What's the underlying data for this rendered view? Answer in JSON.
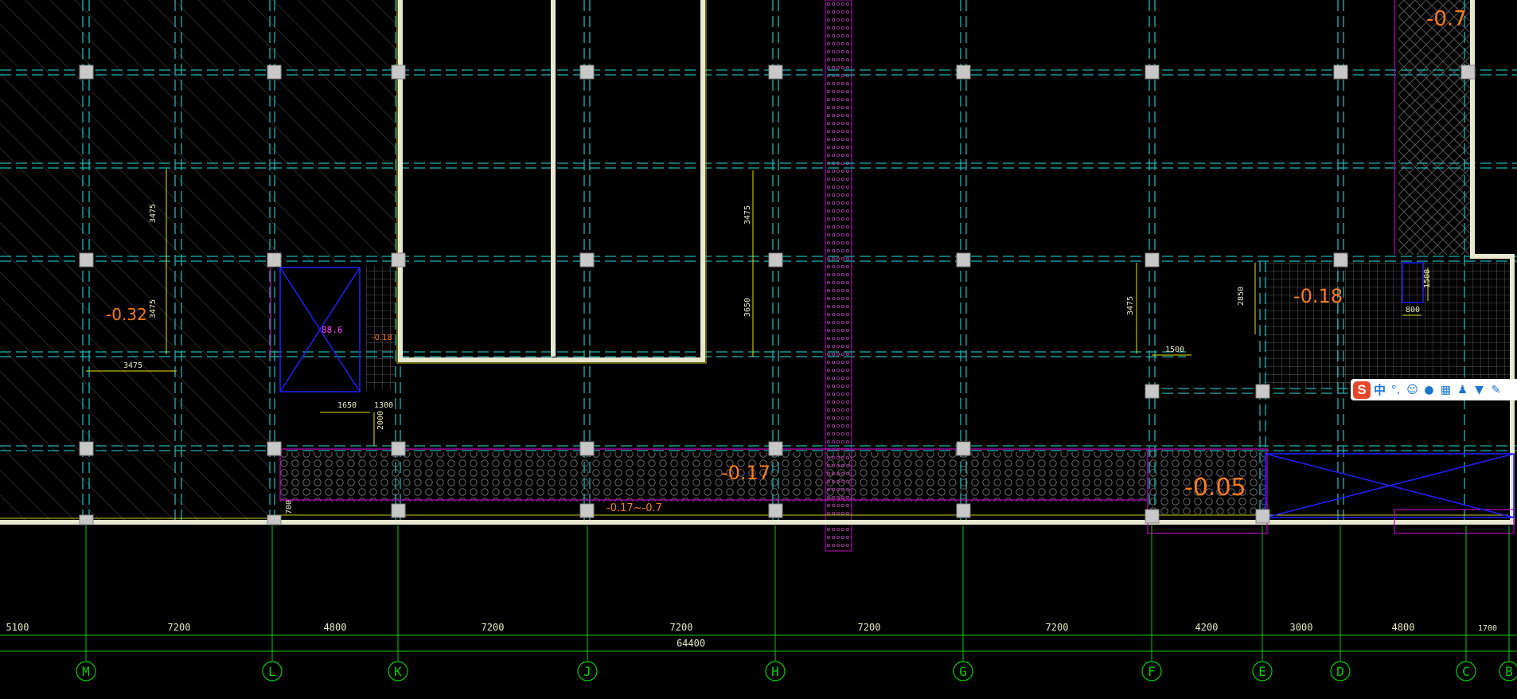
{
  "axis_labels": [
    "M",
    "L",
    "K",
    "J",
    "H",
    "G",
    "F",
    "E",
    "D",
    "C",
    "B"
  ],
  "spans": [
    "5100",
    "7200",
    "4800",
    "7200",
    "7200",
    "7200",
    "7200",
    "4200",
    "3000",
    "4800",
    "1700"
  ],
  "total_span": "64400",
  "elevations": {
    "left_zone": "-0.32",
    "pit_small": "-0.18",
    "bottom_band": "-0.17",
    "bottom_band_range": "-0.17~-0.7",
    "right_box": "-0.05",
    "right_grid": "-0.18",
    "top_right": "-0.7"
  },
  "dims": {
    "v3475_left_top": "3475",
    "v3475_left_bottom": "3475",
    "h3475_left": "3475",
    "d1650": "1650",
    "d1300": "1300",
    "d2000": "2000",
    "v3475_mid": "3475",
    "v3650_mid": "3650",
    "v3475_right": "3475",
    "d1500": "1500",
    "d2850": "2850",
    "d800": "800",
    "d1500b": "1500",
    "d700": "700"
  },
  "shaft_label": "88.6",
  "ime_toolbar": {
    "logo": "S",
    "mode": "中",
    "punct": "°,",
    "icons": [
      "emoji-icon",
      "microphone-icon",
      "keyboard-icon",
      "user-icon",
      "skin-icon",
      "settings-icon"
    ]
  },
  "colors": {
    "background": "#000000",
    "grid_line": "#1cb5b5",
    "wall": "#e8e8d0",
    "column": "#c8c8c8",
    "axis": "#00d000",
    "elevation": "#ff7a1a",
    "dimension": "#e8e800",
    "shaft": "#2020ff",
    "magenta": "#c000c0"
  }
}
